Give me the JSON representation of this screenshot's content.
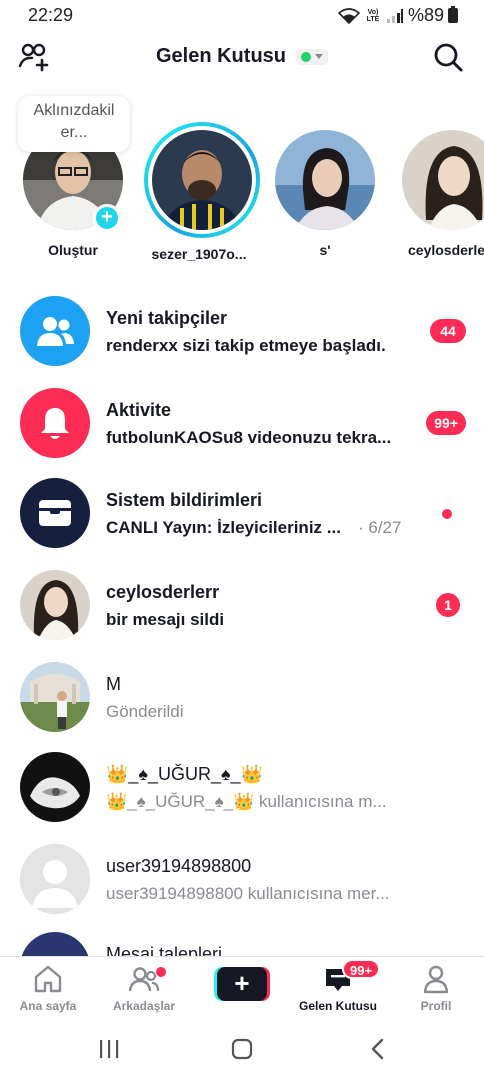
{
  "status_bar": {
    "time": "22:29",
    "network": "Vo) LTE",
    "battery": "%89"
  },
  "header": {
    "title": "Gelen Kutusu",
    "status_color": "#20d56a"
  },
  "stories": {
    "note_text": "Aklınızdakil er...",
    "items": [
      {
        "name": "Oluştur"
      },
      {
        "name": "sezer_1907o..."
      },
      {
        "name": "s'"
      },
      {
        "name": "ceylosderle"
      }
    ]
  },
  "inbox": {
    "rows": [
      {
        "title": "Yeni takipçiler",
        "subtitle": "renderxx sizi takip etmeye başladı.",
        "badge": "44"
      },
      {
        "title": "Aktivite",
        "subtitle": "futbolunKAOSu8 videonuzu tekra...",
        "badge": "99+"
      },
      {
        "title": "Sistem bildirimleri",
        "subtitle": "CANLI Yayın: İzleyicileriniz ...",
        "time": "· 6/27"
      },
      {
        "title": "ceylosderlerr",
        "subtitle": "bir mesajı sildi",
        "badge": "1"
      },
      {
        "title": "M",
        "subtitle": "Gönderildi"
      },
      {
        "title": "👑_♠_UĞUR_♠_👑",
        "subtitle": "👑_♠_UĞUR_♠_👑 kullanıcısına m..."
      },
      {
        "title": "user39194898800",
        "subtitle": "user39194898800 kullanıcısına mer..."
      },
      {
        "title": "Mesaj talepleri"
      }
    ]
  },
  "bottom_nav": {
    "home": "Ana sayfa",
    "friends": "Arkadaşlar",
    "inbox": "Gelen Kutusu",
    "inbox_badge": "99+",
    "profile": "Profil"
  },
  "colors": {
    "accent_red": "#fe2c55",
    "accent_cyan": "#25f4ee",
    "followers_icon_bg": "#1da1f2",
    "activity_icon_bg": "#fe2c55",
    "system_icon_bg": "#161f3d"
  }
}
